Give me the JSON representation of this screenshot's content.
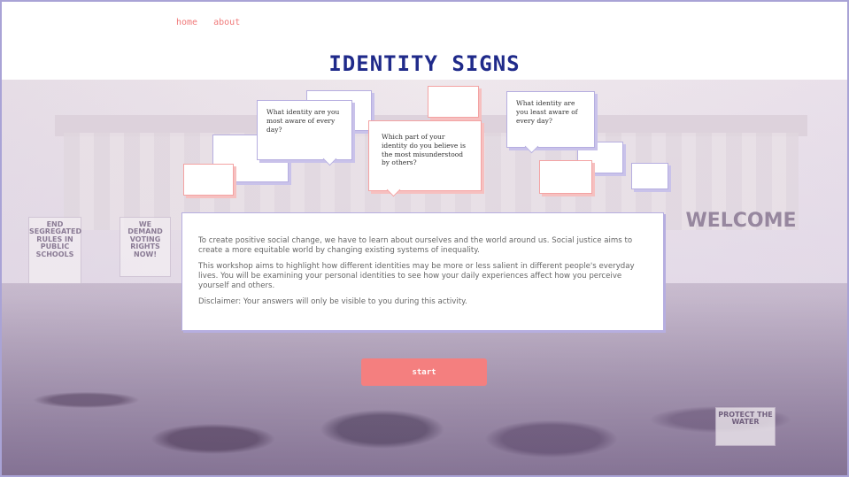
{
  "nav": {
    "home": "home",
    "about": "about"
  },
  "title": "IDENTITY SIGNS",
  "questions": {
    "q1": "What identity are you most aware of every day?",
    "q2": "Which part of your identity do you believe is the most misunderstood by others?",
    "q3": "What identity are you least aware of every day?"
  },
  "intro": {
    "p1": "To create positive social change, we have to learn about ourselves and the world around us. Social justice aims to create a more equitable world by changing existing systems of inequality.",
    "p2": "This workshop aims to highlight how different identities may be more or less salient in different people's everyday lives. You will be examining your personal identities to see how your daily experiences affect how you perceive yourself and others.",
    "p3": "Disclaimer: Your answers will only be visible to you during this activity."
  },
  "start_label": "start",
  "background_signs": {
    "s1": "END SEGREGATED RULES IN PUBLIC SCHOOLS",
    "s2": "WE DEMAND VOTING RIGHTS NOW!",
    "s3": "WELCOME",
    "s4": "PROTECT THE WATER"
  },
  "colors": {
    "accent": "#f47f7f",
    "title": "#1f2a8a",
    "bubble_border": "#b6aee0"
  }
}
